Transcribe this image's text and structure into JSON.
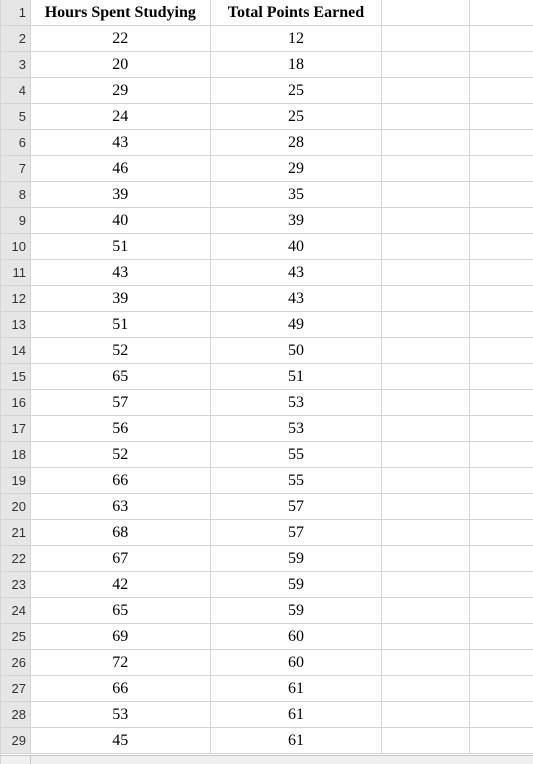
{
  "sheet": {
    "row_numbers": [
      1,
      2,
      3,
      4,
      5,
      6,
      7,
      8,
      9,
      10,
      11,
      12,
      13,
      14,
      15,
      16,
      17,
      18,
      19,
      20,
      21,
      22,
      23,
      24,
      25,
      26,
      27,
      28,
      29
    ],
    "headers": {
      "col_b": "Hours Spent Studying",
      "col_c": "Total Points Earned"
    },
    "data": [
      {
        "b": "22",
        "c": "12"
      },
      {
        "b": "20",
        "c": "18"
      },
      {
        "b": "29",
        "c": "25"
      },
      {
        "b": "24",
        "c": "25"
      },
      {
        "b": "43",
        "c": "28"
      },
      {
        "b": "46",
        "c": "29"
      },
      {
        "b": "39",
        "c": "35"
      },
      {
        "b": "40",
        "c": "39"
      },
      {
        "b": "51",
        "c": "40"
      },
      {
        "b": "43",
        "c": "43"
      },
      {
        "b": "39",
        "c": "43"
      },
      {
        "b": "51",
        "c": "49"
      },
      {
        "b": "52",
        "c": "50"
      },
      {
        "b": "65",
        "c": "51"
      },
      {
        "b": "57",
        "c": "53"
      },
      {
        "b": "56",
        "c": "53"
      },
      {
        "b": "52",
        "c": "55"
      },
      {
        "b": "66",
        "c": "55"
      },
      {
        "b": "63",
        "c": "57"
      },
      {
        "b": "68",
        "c": "57"
      },
      {
        "b": "67",
        "c": "59"
      },
      {
        "b": "42",
        "c": "59"
      },
      {
        "b": "65",
        "c": "59"
      },
      {
        "b": "69",
        "c": "60"
      },
      {
        "b": "72",
        "c": "60"
      },
      {
        "b": "66",
        "c": "61"
      },
      {
        "b": "53",
        "c": "61"
      },
      {
        "b": "45",
        "c": "61"
      }
    ]
  },
  "chart_data": {
    "type": "table",
    "title": "",
    "columns": [
      "Hours Spent Studying",
      "Total Points Earned"
    ],
    "rows": [
      [
        22,
        12
      ],
      [
        20,
        18
      ],
      [
        29,
        25
      ],
      [
        24,
        25
      ],
      [
        43,
        28
      ],
      [
        46,
        29
      ],
      [
        39,
        35
      ],
      [
        40,
        39
      ],
      [
        51,
        40
      ],
      [
        43,
        43
      ],
      [
        39,
        43
      ],
      [
        51,
        49
      ],
      [
        52,
        50
      ],
      [
        65,
        51
      ],
      [
        57,
        53
      ],
      [
        56,
        53
      ],
      [
        52,
        55
      ],
      [
        66,
        55
      ],
      [
        63,
        57
      ],
      [
        68,
        57
      ],
      [
        67,
        59
      ],
      [
        42,
        59
      ],
      [
        65,
        59
      ],
      [
        69,
        60
      ],
      [
        72,
        60
      ],
      [
        66,
        61
      ],
      [
        53,
        61
      ],
      [
        45,
        61
      ]
    ]
  }
}
